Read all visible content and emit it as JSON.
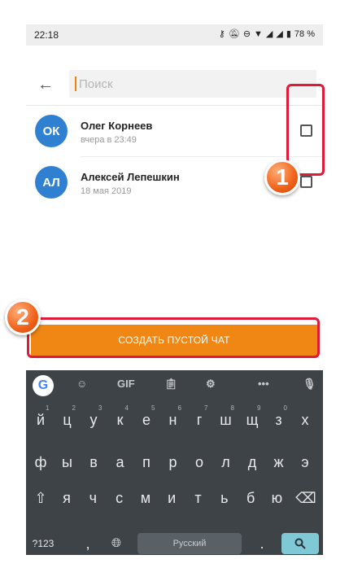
{
  "status": {
    "time": "22:18",
    "battery": "78 %"
  },
  "search": {
    "placeholder": "Поиск"
  },
  "contacts": [
    {
      "initials": "ОК",
      "name": "Олег Корнеев",
      "subtitle": "вчера в 23:49"
    },
    {
      "initials": "АЛ",
      "name": "Алексей Лепешкин",
      "subtitle": "18 мая 2019"
    }
  ],
  "create_button": {
    "label": "СОЗДАТЬ ПУСТОЙ ЧАТ"
  },
  "keyboard": {
    "toolbar_gif": "GIF",
    "toolbar_more": "•••",
    "row1": [
      "й",
      "ц",
      "у",
      "к",
      "е",
      "н",
      "г",
      "ш",
      "щ",
      "з",
      "х"
    ],
    "row1_sub": [
      "1",
      "2",
      "3",
      "4",
      "5",
      "6",
      "7",
      "8",
      "9",
      "0",
      ""
    ],
    "row2": [
      "ф",
      "ы",
      "в",
      "а",
      "п",
      "р",
      "о",
      "л",
      "д",
      "ж",
      "э"
    ],
    "row3": [
      "я",
      "ч",
      "с",
      "м",
      "и",
      "т",
      "ь",
      "б",
      "ю"
    ],
    "numbers_key": "?123",
    "comma": ",",
    "period": ".",
    "space_label": "Русский"
  },
  "annotations": {
    "badge1": "1",
    "badge2": "2"
  },
  "colors": {
    "accent": "#f08613",
    "avatar": "#2f80d1",
    "annotation_red": "#e01b3a"
  }
}
